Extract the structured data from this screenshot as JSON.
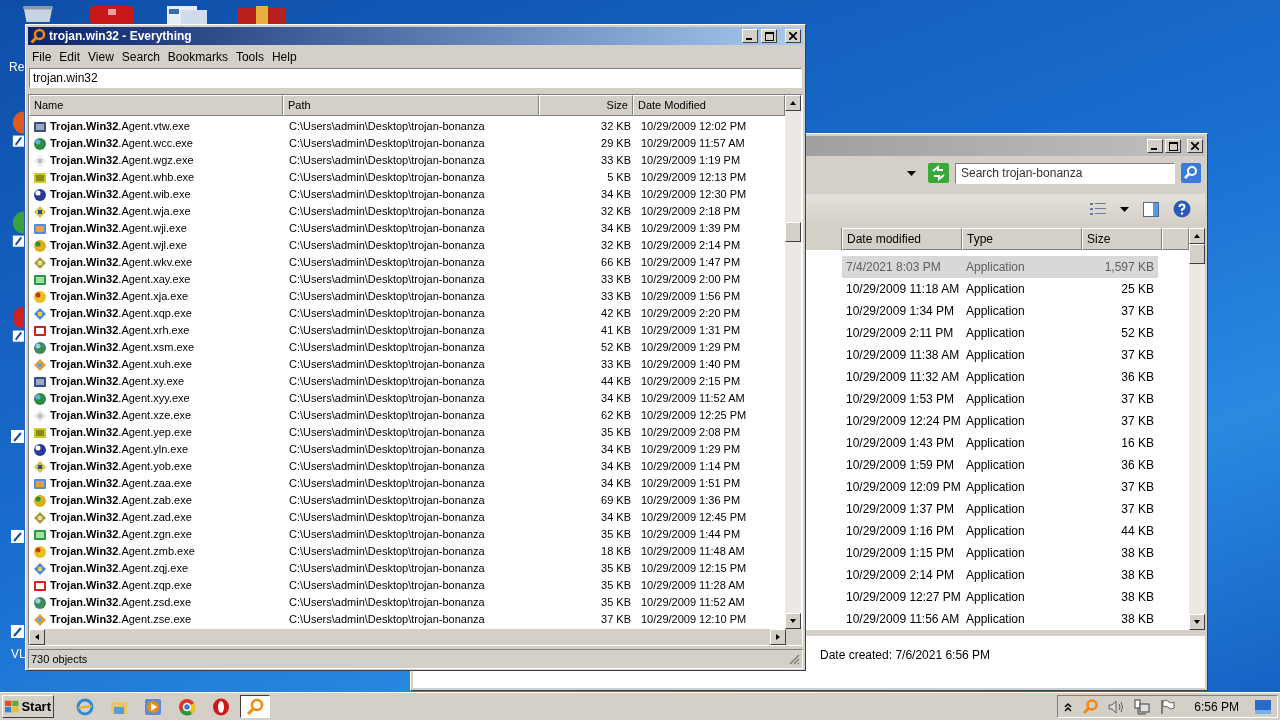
{
  "desktop": {
    "icon_labels": [
      "Re",
      "VL"
    ]
  },
  "everything": {
    "title": "trojan.win32 - Everything",
    "menu": [
      "File",
      "Edit",
      "View",
      "Search",
      "Bookmarks",
      "Tools",
      "Help"
    ],
    "search": {
      "value": "trojan.win32"
    },
    "columns": [
      "Name",
      "Path",
      "Size",
      "Date Modified"
    ],
    "rows": [
      {
        "name": "**Trojan.Win32**.Agent.vtw.exe",
        "path": "C:\\Users\\admin\\Desktop\\trojan-bonanza",
        "size": "32 KB",
        "date": "10/29/2009 12:02 PM"
      },
      {
        "name": "**Trojan.Win32**.Agent.wcc.exe",
        "path": "C:\\Users\\admin\\Desktop\\trojan-bonanza",
        "size": "29 KB",
        "date": "10/29/2009 11:57 AM"
      },
      {
        "name": "**Trojan.Win32**.Agent.wgz.exe",
        "path": "C:\\Users\\admin\\Desktop\\trojan-bonanza",
        "size": "33 KB",
        "date": "10/29/2009 1:19 PM"
      },
      {
        "name": "**Trojan.Win32**.Agent.whb.exe",
        "path": "C:\\Users\\admin\\Desktop\\trojan-bonanza",
        "size": "5 KB",
        "date": "10/29/2009 12:13 PM"
      },
      {
        "name": "**Trojan.Win32**.Agent.wib.exe",
        "path": "C:\\Users\\admin\\Desktop\\trojan-bonanza",
        "size": "34 KB",
        "date": "10/29/2009 12:30 PM"
      },
      {
        "name": "**Trojan.Win32**.Agent.wja.exe",
        "path": "C:\\Users\\admin\\Desktop\\trojan-bonanza",
        "size": "32 KB",
        "date": "10/29/2009 2:18 PM"
      },
      {
        "name": "**Trojan.Win32**.Agent.wji.exe",
        "path": "C:\\Users\\admin\\Desktop\\trojan-bonanza",
        "size": "34 KB",
        "date": "10/29/2009 1:39 PM"
      },
      {
        "name": "**Trojan.Win32**.Agent.wjl.exe",
        "path": "C:\\Users\\admin\\Desktop\\trojan-bonanza",
        "size": "32 KB",
        "date": "10/29/2009 2:14 PM"
      },
      {
        "name": "**Trojan.Win32**.Agent.wkv.exe",
        "path": "C:\\Users\\admin\\Desktop\\trojan-bonanza",
        "size": "66 KB",
        "date": "10/29/2009 1:47 PM"
      },
      {
        "name": "**Trojan.Win32**.Agent.xay.exe",
        "path": "C:\\Users\\admin\\Desktop\\trojan-bonanza",
        "size": "33 KB",
        "date": "10/29/2009 2:00 PM"
      },
      {
        "name": "**Trojan.Win32**.Agent.xja.exe",
        "path": "C:\\Users\\admin\\Desktop\\trojan-bonanza",
        "size": "33 KB",
        "date": "10/29/2009 1:56 PM"
      },
      {
        "name": "**Trojan.Win32**.Agent.xqp.exe",
        "path": "C:\\Users\\admin\\Desktop\\trojan-bonanza",
        "size": "42 KB",
        "date": "10/29/2009 2:20 PM"
      },
      {
        "name": "**Trojan.Win32**.Agent.xrh.exe",
        "path": "C:\\Users\\admin\\Desktop\\trojan-bonanza",
        "size": "41 KB",
        "date": "10/29/2009 1:31 PM"
      },
      {
        "name": "**Trojan.Win32**.Agent.xsm.exe",
        "path": "C:\\Users\\admin\\Desktop\\trojan-bonanza",
        "size": "52 KB",
        "date": "10/29/2009 1:29 PM"
      },
      {
        "name": "**Trojan.Win32**.Agent.xuh.exe",
        "path": "C:\\Users\\admin\\Desktop\\trojan-bonanza",
        "size": "33 KB",
        "date": "10/29/2009 1:40 PM"
      },
      {
        "name": "**Trojan.Win32**.Agent.xy.exe",
        "path": "C:\\Users\\admin\\Desktop\\trojan-bonanza",
        "size": "44 KB",
        "date": "10/29/2009 2:15 PM"
      },
      {
        "name": "**Trojan.Win32**.Agent.xyy.exe",
        "path": "C:\\Users\\admin\\Desktop\\trojan-bonanza",
        "size": "34 KB",
        "date": "10/29/2009 11:52 AM"
      },
      {
        "name": "**Trojan.Win32**.Agent.xze.exe",
        "path": "C:\\Users\\admin\\Desktop\\trojan-bonanza",
        "size": "62 KB",
        "date": "10/29/2009 12:25 PM"
      },
      {
        "name": "**Trojan.Win32**.Agent.yep.exe",
        "path": "C:\\Users\\admin\\Desktop\\trojan-bonanza",
        "size": "35 KB",
        "date": "10/29/2009 2:08 PM"
      },
      {
        "name": "**Trojan.Win32**.Agent.yln.exe",
        "path": "C:\\Users\\admin\\Desktop\\trojan-bonanza",
        "size": "34 KB",
        "date": "10/29/2009 1:29 PM"
      },
      {
        "name": "**Trojan.Win32**.Agent.yob.exe",
        "path": "C:\\Users\\admin\\Desktop\\trojan-bonanza",
        "size": "34 KB",
        "date": "10/29/2009 1:14 PM"
      },
      {
        "name": "**Trojan.Win32**.Agent.zaa.exe",
        "path": "C:\\Users\\admin\\Desktop\\trojan-bonanza",
        "size": "34 KB",
        "date": "10/29/2009 1:51 PM"
      },
      {
        "name": "**Trojan.Win32**.Agent.zab.exe",
        "path": "C:\\Users\\admin\\Desktop\\trojan-bonanza",
        "size": "69 KB",
        "date": "10/29/2009 1:36 PM"
      },
      {
        "name": "**Trojan.Win32**.Agent.zad.exe",
        "path": "C:\\Users\\admin\\Desktop\\trojan-bonanza",
        "size": "34 KB",
        "date": "10/29/2009 12:45 PM"
      },
      {
        "name": "**Trojan.Win32**.Agent.zgn.exe",
        "path": "C:\\Users\\admin\\Desktop\\trojan-bonanza",
        "size": "35 KB",
        "date": "10/29/2009 1:44 PM"
      },
      {
        "name": "**Trojan.Win32**.Agent.zmb.exe",
        "path": "C:\\Users\\admin\\Desktop\\trojan-bonanza",
        "size": "18 KB",
        "date": "10/29/2009 11:48 AM"
      },
      {
        "name": "**Trojan.Win32**.Agent.zqj.exe",
        "path": "C:\\Users\\admin\\Desktop\\trojan-bonanza",
        "size": "35 KB",
        "date": "10/29/2009 12:15 PM"
      },
      {
        "name": "**Trojan.Win32**.Agent.zqp.exe",
        "path": "C:\\Users\\admin\\Desktop\\trojan-bonanza",
        "size": "35 KB",
        "date": "10/29/2009 11:28 AM"
      },
      {
        "name": "**Trojan.Win32**.Agent.zsd.exe",
        "path": "C:\\Users\\admin\\Desktop\\trojan-bonanza",
        "size": "35 KB",
        "date": "10/29/2009 11:52 AM"
      },
      {
        "name": "**Trojan.Win32**.Agent.zse.exe",
        "path": "C:\\Users\\admin\\Desktop\\trojan-bonanza",
        "size": "37 KB",
        "date": "10/29/2009 12:10 PM"
      }
    ],
    "status": "730 objects"
  },
  "explorer": {
    "search": {
      "placeholder": "Search trojan-bonanza"
    },
    "columns": [
      "Date modified",
      "Type",
      "Size"
    ],
    "rows": [
      {
        "date": "7/4/2021 8:03 PM",
        "type": "Application",
        "size": "1,597 KB",
        "selected": true
      },
      {
        "date": "10/29/2009 11:18 AM",
        "type": "Application",
        "size": "25 KB",
        "selected": false
      },
      {
        "date": "10/29/2009 1:34 PM",
        "type": "Application",
        "size": "37 KB",
        "selected": false
      },
      {
        "date": "10/29/2009 2:11 PM",
        "type": "Application",
        "size": "52 KB",
        "selected": false
      },
      {
        "date": "10/29/2009 11:38 AM",
        "type": "Application",
        "size": "37 KB",
        "selected": false
      },
      {
        "date": "10/29/2009 11:32 AM",
        "type": "Application",
        "size": "36 KB",
        "selected": false
      },
      {
        "date": "10/29/2009 1:53 PM",
        "type": "Application",
        "size": "37 KB",
        "selected": false
      },
      {
        "date": "10/29/2009 12:24 PM",
        "type": "Application",
        "size": "37 KB",
        "selected": false
      },
      {
        "date": "10/29/2009 1:43 PM",
        "type": "Application",
        "size": "16 KB",
        "selected": false
      },
      {
        "date": "10/29/2009 1:59 PM",
        "type": "Application",
        "size": "36 KB",
        "selected": false
      },
      {
        "date": "10/29/2009 12:09 PM",
        "type": "Application",
        "size": "37 KB",
        "selected": false
      },
      {
        "date": "10/29/2009 1:37 PM",
        "type": "Application",
        "size": "37 KB",
        "selected": false
      },
      {
        "date": "10/29/2009 1:16 PM",
        "type": "Application",
        "size": "44 KB",
        "selected": false
      },
      {
        "date": "10/29/2009 1:15 PM",
        "type": "Application",
        "size": "38 KB",
        "selected": false
      },
      {
        "date": "10/29/2009 2:14 PM",
        "type": "Application",
        "size": "38 KB",
        "selected": false
      },
      {
        "date": "10/29/2009 12:27 PM",
        "type": "Application",
        "size": "38 KB",
        "selected": false
      },
      {
        "date": "10/29/2009 11:56 AM",
        "type": "Application",
        "size": "38 KB",
        "selected": false
      }
    ],
    "details": "Date created: 7/6/2021 6:56 PM"
  },
  "taskbar": {
    "start": "Start",
    "apps": [
      {
        "kind": "globe",
        "selected": false
      },
      {
        "kind": "folder",
        "selected": false
      },
      {
        "kind": "player",
        "selected": false
      },
      {
        "kind": "chrome",
        "selected": false
      },
      {
        "kind": "opera",
        "selected": false
      },
      {
        "kind": "magnifier",
        "selected": true
      }
    ],
    "clock": "6:56 PM"
  }
}
